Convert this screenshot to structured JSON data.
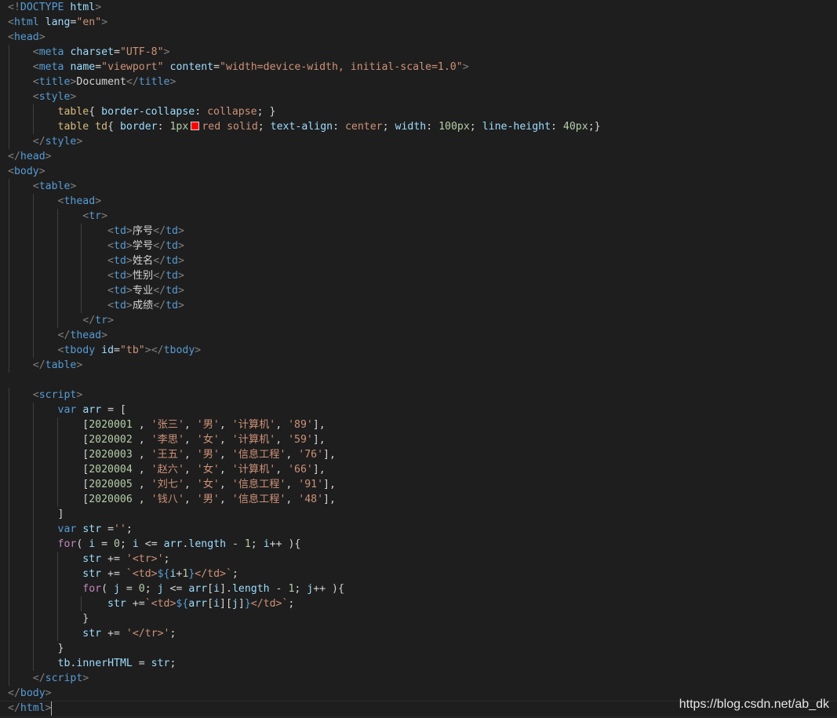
{
  "editor": {
    "watermark": "https://blog.csdn.net/ab_dk",
    "swatch_color": "#ff0000",
    "lines": [
      [
        [
          "br",
          "<!"
        ],
        [
          "tag",
          "DOCTYPE"
        ],
        [
          "text",
          " "
        ],
        [
          "attr",
          "html"
        ],
        [
          "br",
          ">"
        ]
      ],
      [
        [
          "br",
          "<"
        ],
        [
          "tag",
          "html"
        ],
        [
          "text",
          " "
        ],
        [
          "attr",
          "lang"
        ],
        [
          "text",
          "="
        ],
        [
          "str",
          "\"en\""
        ],
        [
          "br",
          ">"
        ]
      ],
      [
        [
          "br",
          "<"
        ],
        [
          "tag",
          "head"
        ],
        [
          "br",
          ">"
        ]
      ],
      [
        [
          "text",
          "    "
        ],
        [
          "br",
          "<"
        ],
        [
          "tag",
          "meta"
        ],
        [
          "text",
          " "
        ],
        [
          "attr",
          "charset"
        ],
        [
          "text",
          "="
        ],
        [
          "str",
          "\"UTF-8\""
        ],
        [
          "br",
          ">"
        ]
      ],
      [
        [
          "text",
          "    "
        ],
        [
          "br",
          "<"
        ],
        [
          "tag",
          "meta"
        ],
        [
          "text",
          " "
        ],
        [
          "attr",
          "name"
        ],
        [
          "text",
          "="
        ],
        [
          "str",
          "\"viewport\""
        ],
        [
          "text",
          " "
        ],
        [
          "attr",
          "content"
        ],
        [
          "text",
          "="
        ],
        [
          "str",
          "\"width=device-width, initial-scale=1.0\""
        ],
        [
          "br",
          ">"
        ]
      ],
      [
        [
          "text",
          "    "
        ],
        [
          "br",
          "<"
        ],
        [
          "tag",
          "title"
        ],
        [
          "br",
          ">"
        ],
        [
          "text",
          "Document"
        ],
        [
          "br",
          "</"
        ],
        [
          "tag",
          "title"
        ],
        [
          "br",
          ">"
        ]
      ],
      [
        [
          "text",
          "    "
        ],
        [
          "br",
          "<"
        ],
        [
          "tag",
          "style"
        ],
        [
          "br",
          ">"
        ]
      ],
      [
        [
          "text",
          "        "
        ],
        [
          "sel",
          "table"
        ],
        [
          "text",
          "{ "
        ],
        [
          "prop",
          "border-collapse"
        ],
        [
          "text",
          ": "
        ],
        [
          "val",
          "collapse"
        ],
        [
          "text",
          "; }"
        ]
      ],
      [
        [
          "text",
          "        "
        ],
        [
          "sel",
          "table td"
        ],
        [
          "text",
          "{ "
        ],
        [
          "prop",
          "border"
        ],
        [
          "text",
          ": "
        ],
        [
          "num",
          "1px"
        ],
        [
          "swatch",
          ""
        ],
        [
          "val",
          "red solid"
        ],
        [
          "text",
          "; "
        ],
        [
          "prop",
          "text-align"
        ],
        [
          "text",
          ": "
        ],
        [
          "val",
          "center"
        ],
        [
          "text",
          "; "
        ],
        [
          "prop",
          "width"
        ],
        [
          "text",
          ": "
        ],
        [
          "num",
          "100px"
        ],
        [
          "text",
          "; "
        ],
        [
          "prop",
          "line-height"
        ],
        [
          "text",
          ": "
        ],
        [
          "num",
          "40px"
        ],
        [
          "text",
          ";}"
        ]
      ],
      [
        [
          "text",
          "    "
        ],
        [
          "br",
          "</"
        ],
        [
          "tag",
          "style"
        ],
        [
          "br",
          ">"
        ]
      ],
      [
        [
          "br",
          "</"
        ],
        [
          "tag",
          "head"
        ],
        [
          "br",
          ">"
        ]
      ],
      [
        [
          "br",
          "<"
        ],
        [
          "tag",
          "body"
        ],
        [
          "br",
          ">"
        ]
      ],
      [
        [
          "text",
          "    "
        ],
        [
          "br",
          "<"
        ],
        [
          "tag",
          "table"
        ],
        [
          "br",
          ">"
        ]
      ],
      [
        [
          "text",
          "        "
        ],
        [
          "br",
          "<"
        ],
        [
          "tag",
          "thead"
        ],
        [
          "br",
          ">"
        ]
      ],
      [
        [
          "text",
          "            "
        ],
        [
          "br",
          "<"
        ],
        [
          "tag",
          "tr"
        ],
        [
          "br",
          ">"
        ]
      ],
      [
        [
          "text",
          "                "
        ],
        [
          "br",
          "<"
        ],
        [
          "tag",
          "td"
        ],
        [
          "br",
          ">"
        ],
        [
          "text",
          "序号"
        ],
        [
          "br",
          "</"
        ],
        [
          "tag",
          "td"
        ],
        [
          "br",
          ">"
        ]
      ],
      [
        [
          "text",
          "                "
        ],
        [
          "br",
          "<"
        ],
        [
          "tag",
          "td"
        ],
        [
          "br",
          ">"
        ],
        [
          "text",
          "学号"
        ],
        [
          "br",
          "</"
        ],
        [
          "tag",
          "td"
        ],
        [
          "br",
          ">"
        ]
      ],
      [
        [
          "text",
          "                "
        ],
        [
          "br",
          "<"
        ],
        [
          "tag",
          "td"
        ],
        [
          "br",
          ">"
        ],
        [
          "text",
          "姓名"
        ],
        [
          "br",
          "</"
        ],
        [
          "tag",
          "td"
        ],
        [
          "br",
          ">"
        ]
      ],
      [
        [
          "text",
          "                "
        ],
        [
          "br",
          "<"
        ],
        [
          "tag",
          "td"
        ],
        [
          "br",
          ">"
        ],
        [
          "text",
          "性别"
        ],
        [
          "br",
          "</"
        ],
        [
          "tag",
          "td"
        ],
        [
          "br",
          ">"
        ]
      ],
      [
        [
          "text",
          "                "
        ],
        [
          "br",
          "<"
        ],
        [
          "tag",
          "td"
        ],
        [
          "br",
          ">"
        ],
        [
          "text",
          "专业"
        ],
        [
          "br",
          "</"
        ],
        [
          "tag",
          "td"
        ],
        [
          "br",
          ">"
        ]
      ],
      [
        [
          "text",
          "                "
        ],
        [
          "br",
          "<"
        ],
        [
          "tag",
          "td"
        ],
        [
          "br",
          ">"
        ],
        [
          "text",
          "成绩"
        ],
        [
          "br",
          "</"
        ],
        [
          "tag",
          "td"
        ],
        [
          "br",
          ">"
        ]
      ],
      [
        [
          "text",
          "            "
        ],
        [
          "br",
          "</"
        ],
        [
          "tag",
          "tr"
        ],
        [
          "br",
          ">"
        ]
      ],
      [
        [
          "text",
          "        "
        ],
        [
          "br",
          "</"
        ],
        [
          "tag",
          "thead"
        ],
        [
          "br",
          ">"
        ]
      ],
      [
        [
          "text",
          "        "
        ],
        [
          "br",
          "<"
        ],
        [
          "tag",
          "tbody"
        ],
        [
          "text",
          " "
        ],
        [
          "attr",
          "id"
        ],
        [
          "text",
          "="
        ],
        [
          "str",
          "\"tb\""
        ],
        [
          "br",
          "></"
        ],
        [
          "tag",
          "tbody"
        ],
        [
          "br",
          ">"
        ]
      ],
      [
        [
          "text",
          "    "
        ],
        [
          "br",
          "</"
        ],
        [
          "tag",
          "table"
        ],
        [
          "br",
          ">"
        ]
      ],
      [],
      [
        [
          "text",
          "    "
        ],
        [
          "br",
          "<"
        ],
        [
          "tag",
          "script"
        ],
        [
          "br",
          ">"
        ]
      ],
      [
        [
          "text",
          "        "
        ],
        [
          "kw",
          "var"
        ],
        [
          "text",
          " "
        ],
        [
          "var",
          "arr"
        ],
        [
          "text",
          " = ["
        ]
      ],
      [
        [
          "text",
          "            ["
        ],
        [
          "num",
          "2020001"
        ],
        [
          "text",
          " , "
        ],
        [
          "str",
          "'张三'"
        ],
        [
          "text",
          ", "
        ],
        [
          "str",
          "'男'"
        ],
        [
          "text",
          ", "
        ],
        [
          "str",
          "'计算机'"
        ],
        [
          "text",
          ", "
        ],
        [
          "str",
          "'89'"
        ],
        [
          "text",
          "],"
        ]
      ],
      [
        [
          "text",
          "            ["
        ],
        [
          "num",
          "2020002"
        ],
        [
          "text",
          " , "
        ],
        [
          "str",
          "'李思'"
        ],
        [
          "text",
          ", "
        ],
        [
          "str",
          "'女'"
        ],
        [
          "text",
          ", "
        ],
        [
          "str",
          "'计算机'"
        ],
        [
          "text",
          ", "
        ],
        [
          "str",
          "'59'"
        ],
        [
          "text",
          "],"
        ]
      ],
      [
        [
          "text",
          "            ["
        ],
        [
          "num",
          "2020003"
        ],
        [
          "text",
          " , "
        ],
        [
          "str",
          "'王五'"
        ],
        [
          "text",
          ", "
        ],
        [
          "str",
          "'男'"
        ],
        [
          "text",
          ", "
        ],
        [
          "str",
          "'信息工程'"
        ],
        [
          "text",
          ", "
        ],
        [
          "str",
          "'76'"
        ],
        [
          "text",
          "],"
        ]
      ],
      [
        [
          "text",
          "            ["
        ],
        [
          "num",
          "2020004"
        ],
        [
          "text",
          " , "
        ],
        [
          "str",
          "'赵六'"
        ],
        [
          "text",
          ", "
        ],
        [
          "str",
          "'女'"
        ],
        [
          "text",
          ", "
        ],
        [
          "str",
          "'计算机'"
        ],
        [
          "text",
          ", "
        ],
        [
          "str",
          "'66'"
        ],
        [
          "text",
          "],"
        ]
      ],
      [
        [
          "text",
          "            ["
        ],
        [
          "num",
          "2020005"
        ],
        [
          "text",
          " , "
        ],
        [
          "str",
          "'刘七'"
        ],
        [
          "text",
          ", "
        ],
        [
          "str",
          "'女'"
        ],
        [
          "text",
          ", "
        ],
        [
          "str",
          "'信息工程'"
        ],
        [
          "text",
          ", "
        ],
        [
          "str",
          "'91'"
        ],
        [
          "text",
          "],"
        ]
      ],
      [
        [
          "text",
          "            ["
        ],
        [
          "num",
          "2020006"
        ],
        [
          "text",
          " , "
        ],
        [
          "str",
          "'钱八'"
        ],
        [
          "text",
          ", "
        ],
        [
          "str",
          "'男'"
        ],
        [
          "text",
          ", "
        ],
        [
          "str",
          "'信息工程'"
        ],
        [
          "text",
          ", "
        ],
        [
          "str",
          "'48'"
        ],
        [
          "text",
          "],"
        ]
      ],
      [
        [
          "text",
          "        ]"
        ]
      ],
      [
        [
          "text",
          "        "
        ],
        [
          "kw",
          "var"
        ],
        [
          "text",
          " "
        ],
        [
          "var",
          "str"
        ],
        [
          "text",
          " ="
        ],
        [
          "str",
          "''"
        ],
        [
          "text",
          ";"
        ]
      ],
      [
        [
          "text",
          "        "
        ],
        [
          "ctrl",
          "for"
        ],
        [
          "text",
          "( "
        ],
        [
          "var",
          "i"
        ],
        [
          "text",
          " = "
        ],
        [
          "num",
          "0"
        ],
        [
          "text",
          "; "
        ],
        [
          "var",
          "i"
        ],
        [
          "text",
          " <= "
        ],
        [
          "var",
          "arr"
        ],
        [
          "text",
          "."
        ],
        [
          "var",
          "length"
        ],
        [
          "text",
          " - "
        ],
        [
          "num",
          "1"
        ],
        [
          "text",
          "; "
        ],
        [
          "var",
          "i"
        ],
        [
          "text",
          "++ ){"
        ]
      ],
      [
        [
          "text",
          "            "
        ],
        [
          "var",
          "str"
        ],
        [
          "text",
          " += "
        ],
        [
          "str",
          "'<tr>'"
        ],
        [
          "text",
          ";"
        ]
      ],
      [
        [
          "text",
          "            "
        ],
        [
          "var",
          "str"
        ],
        [
          "text",
          " += "
        ],
        [
          "str",
          "`<td>"
        ],
        [
          "tpl",
          "${"
        ],
        [
          "var",
          "i"
        ],
        [
          "text",
          "+"
        ],
        [
          "num",
          "1"
        ],
        [
          "tpl",
          "}"
        ],
        [
          "str",
          "</td>`"
        ],
        [
          "text",
          ";"
        ]
      ],
      [
        [
          "text",
          "            "
        ],
        [
          "ctrl",
          "for"
        ],
        [
          "text",
          "( "
        ],
        [
          "var",
          "j"
        ],
        [
          "text",
          " = "
        ],
        [
          "num",
          "0"
        ],
        [
          "text",
          "; "
        ],
        [
          "var",
          "j"
        ],
        [
          "text",
          " <= "
        ],
        [
          "var",
          "arr"
        ],
        [
          "text",
          "["
        ],
        [
          "var",
          "i"
        ],
        [
          "text",
          "]."
        ],
        [
          "var",
          "length"
        ],
        [
          "text",
          " - "
        ],
        [
          "num",
          "1"
        ],
        [
          "text",
          "; "
        ],
        [
          "var",
          "j"
        ],
        [
          "text",
          "++ ){"
        ]
      ],
      [
        [
          "text",
          "                "
        ],
        [
          "var",
          "str"
        ],
        [
          "text",
          " +="
        ],
        [
          "str",
          "`<td>"
        ],
        [
          "tpl",
          "${"
        ],
        [
          "var",
          "arr"
        ],
        [
          "text",
          "["
        ],
        [
          "var",
          "i"
        ],
        [
          "text",
          "]["
        ],
        [
          "var",
          "j"
        ],
        [
          "text",
          "]"
        ],
        [
          "tpl",
          "}"
        ],
        [
          "str",
          "</td>`"
        ],
        [
          "text",
          ";"
        ]
      ],
      [
        [
          "text",
          "            }"
        ]
      ],
      [
        [
          "text",
          "            "
        ],
        [
          "var",
          "str"
        ],
        [
          "text",
          " += "
        ],
        [
          "str",
          "'</tr>'"
        ],
        [
          "text",
          ";"
        ]
      ],
      [
        [
          "text",
          "        }"
        ]
      ],
      [
        [
          "text",
          "        "
        ],
        [
          "var",
          "tb"
        ],
        [
          "text",
          "."
        ],
        [
          "var",
          "innerHTML"
        ],
        [
          "text",
          " = "
        ],
        [
          "var",
          "str"
        ],
        [
          "text",
          ";"
        ]
      ],
      [
        [
          "text",
          "    "
        ],
        [
          "br",
          "</"
        ],
        [
          "tag",
          "script"
        ],
        [
          "br",
          ">"
        ]
      ],
      [
        [
          "br",
          "</"
        ],
        [
          "tag",
          "body"
        ],
        [
          "br",
          ">"
        ]
      ],
      [
        [
          "br",
          "</"
        ],
        [
          "tag",
          "html"
        ],
        [
          "br",
          ">"
        ]
      ]
    ]
  }
}
